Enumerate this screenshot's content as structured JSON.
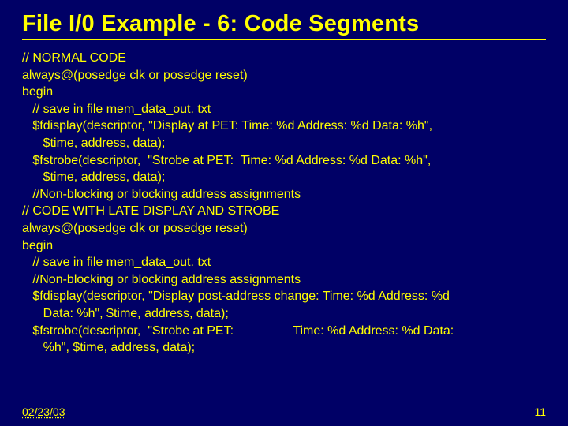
{
  "title": "File I/0 Example - 6: Code Segments",
  "code": {
    "l0": "// NORMAL CODE",
    "l1": "always@(posedge clk or posedge reset)",
    "l2": "begin",
    "l3": "   // save in file mem_data_out. txt",
    "l4": "   $fdisplay(descriptor, \"Display at PET: Time: %d Address: %d Data: %h\",",
    "l5": "      $time, address, data);",
    "l6": "   $fstrobe(descriptor,  \"Strobe at PET:  Time: %d Address: %d Data: %h\",",
    "l7": "      $time, address, data);",
    "l8": "   //Non-blocking or blocking address assignments",
    "l9": "// CODE WITH LATE DISPLAY AND STROBE",
    "l10": "always@(posedge clk or posedge reset)",
    "l11": "begin",
    "l12": "   // save in file mem_data_out. txt",
    "l13": "   //Non-blocking or blocking address assignments",
    "l14": "   $fdisplay(descriptor, \"Display post-address change: Time: %d Address: %d",
    "l15": "      Data: %h\", $time, address, data);",
    "l16": "   $fstrobe(descriptor,  \"Strobe at PET:                 Time: %d Address: %d Data:",
    "l17": "      %h\", $time, address, data);"
  },
  "footer": {
    "date": "02/23/03",
    "pagenum": "11"
  }
}
